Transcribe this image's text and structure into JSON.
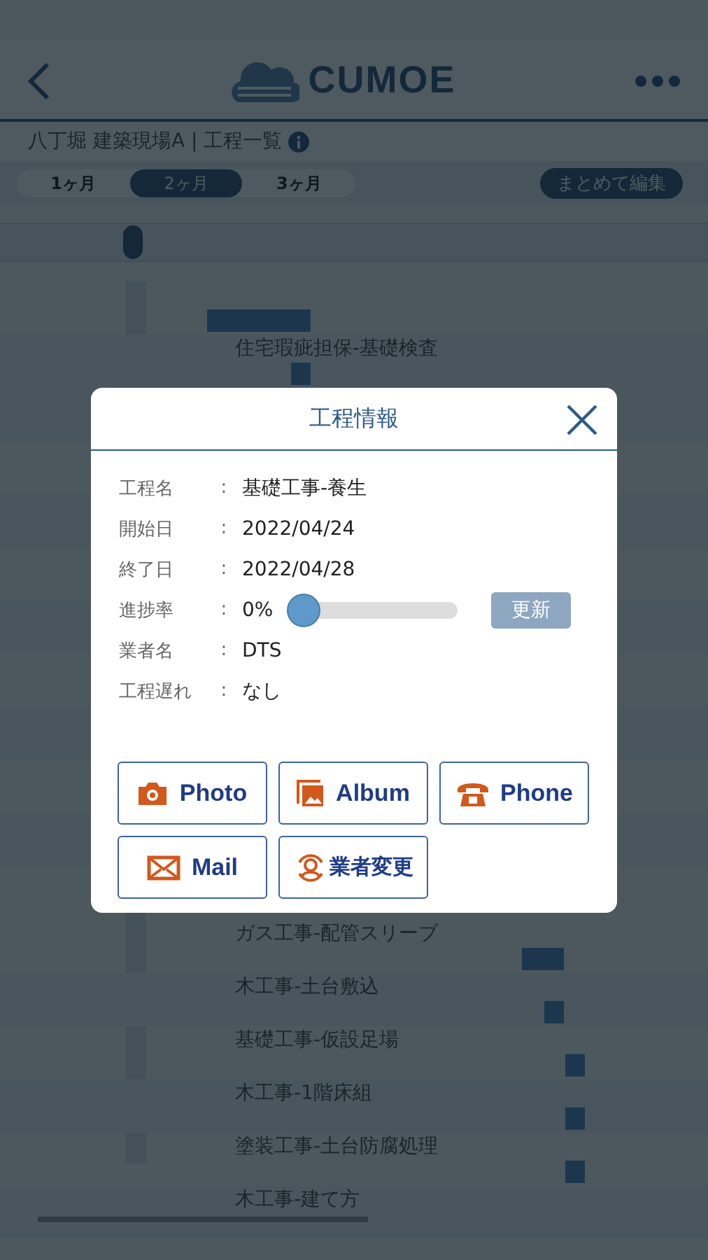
{
  "header": {
    "logo": "CUMOE"
  },
  "breadcrumb": "八丁堀 建築現場A | 工程一覧",
  "range_tabs": [
    {
      "label": "1ヶ月",
      "selected": false
    },
    {
      "label": "2ヶ月",
      "selected": true
    },
    {
      "label": "3ヶ月",
      "selected": false
    }
  ],
  "bulk_edit_button": "まとめて編集",
  "tasks_top": [
    {
      "name": "住宅瑕疵担保-基礎検査"
    }
  ],
  "tasks_bottom": [
    {
      "name": "ガス工事-配管スリーブ"
    },
    {
      "name": "木工事-土台敷込"
    },
    {
      "name": "基礎工事-仮設足場"
    },
    {
      "name": "木工事-1階床組"
    },
    {
      "name": "塗装工事-土台防腐処理"
    },
    {
      "name": "木工事-建て方"
    }
  ],
  "dialog": {
    "title": "工程情報",
    "fields": [
      {
        "label": "工程名",
        "colon": ":",
        "value": "基礎工事-養生",
        "kind": "text"
      },
      {
        "label": "開始日",
        "colon": ":",
        "value": "2022/04/24",
        "kind": "text"
      },
      {
        "label": "終了日",
        "colon": ":",
        "value": "2022/04/28",
        "kind": "text"
      },
      {
        "label": "進捗率",
        "colon": ":",
        "value": "0%",
        "kind": "slider",
        "level": 0,
        "button": "更新"
      },
      {
        "label": "業者名",
        "colon": ":",
        "value": "DTS",
        "kind": "text"
      },
      {
        "label": "工程遅れ",
        "colon": ":",
        "value": "なし",
        "kind": "text"
      }
    ],
    "actions": [
      {
        "label": "Photo",
        "kind": "camera"
      },
      {
        "label": "Album",
        "kind": "album"
      },
      {
        "label": "Phone",
        "kind": "phone"
      },
      {
        "label": "Mail",
        "kind": "mail"
      },
      {
        "label": "業者変更",
        "kind": "swap"
      }
    ]
  }
}
